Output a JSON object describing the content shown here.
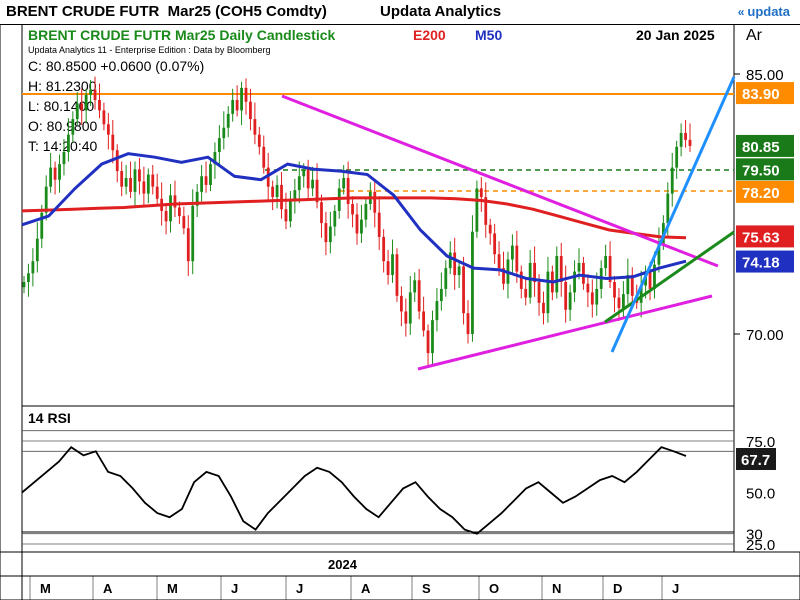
{
  "header": {
    "left": "BRENT CRUDE FUTR  Mar25 (COH5 Comdty)",
    "right": "Updata Analytics",
    "logo": "updata",
    "logo_icon": "chevron-logo-icon"
  },
  "chart_title": {
    "name": "BRENT CRUDE FUTR  Mar25 Daily Candlestick",
    "e200": "E200",
    "m50": "M50",
    "date": "20 Jan 2025",
    "axis_label": "Ar",
    "sub": "Updata Analytics 11 - Enterprise Edition : Data by Bloomberg"
  },
  "ohlc": {
    "c": "C: 80.8500  +0.0600 (0.07%)",
    "h": "H: 81.2300",
    "l": "L: 80.1400",
    "o": "O: 80.9800",
    "t": "T: 14:20:40"
  },
  "colors": {
    "up": "#1a8a1a",
    "down": "#e02020",
    "e200": "#e02020",
    "m50": "#2030c0",
    "magenta": "#e020e0",
    "orange": "#ff8c00",
    "green_dashed": "#1a7a1a",
    "blue_line": "#1e90ff",
    "green_line": "#1a8a1a"
  },
  "chart_data": [
    {
      "type": "candlestick",
      "title": "BRENT CRUDE FUTR  Mar25 Daily Candlestick",
      "y_ticks": [
        85,
        70
      ],
      "y_tick_labels": [
        "85.00",
        "70.00"
      ],
      "ylim": [
        67.4,
        87.0
      ],
      "x_month_labels": [
        "M",
        "A",
        "M",
        "J",
        "J",
        "A",
        "S",
        "O",
        "N",
        "D",
        "J"
      ],
      "x_year_label": "2024",
      "series_closes": [
        73.0,
        73.5,
        74.2,
        75.5,
        77.0,
        78.5,
        79.6,
        78.9,
        79.8,
        80.5,
        81.5,
        82.4,
        83.3,
        82.9,
        83.8,
        84.1,
        83.5,
        82.9,
        82.1,
        81.5,
        80.6,
        79.4,
        78.5,
        79.0,
        78.2,
        79.5,
        78.8,
        78.1,
        79.2,
        78.5,
        77.8,
        77.1,
        76.5,
        78.0,
        77.3,
        76.8,
        76.1,
        74.2,
        77.4,
        78.2,
        79.1,
        78.6,
        79.8,
        80.5,
        81.3,
        81.9,
        82.7,
        83.5,
        82.9,
        84.2,
        83.4,
        82.4,
        81.5,
        80.8,
        79.6,
        78.5,
        77.9,
        78.6,
        77.2,
        76.5,
        77.8,
        78.3,
        79.1,
        79.5,
        78.4,
        78.9,
        77.6,
        76.4,
        75.3,
        76.2,
        77.1,
        78.4,
        79.0,
        77.5,
        76.9,
        75.8,
        76.6,
        77.5,
        78.2,
        77.0,
        75.6,
        74.2,
        73.4,
        74.6,
        72.2,
        71.3,
        70.6,
        72.4,
        73.1,
        71.3,
        70.2,
        68.9,
        70.8,
        71.9,
        72.6,
        73.8,
        74.7,
        73.4,
        73.9,
        71.2,
        70.0,
        75.9,
        78.4,
        77.9,
        76.3,
        75.8,
        74.6,
        73.8,
        72.9,
        74.3,
        75.1,
        73.6,
        72.6,
        72.1,
        74.1,
        73.0,
        71.8,
        71.2,
        73.6,
        72.4,
        74.5,
        73.0,
        71.4,
        72.4,
        73.6,
        74.1,
        72.9,
        72.4,
        71.7,
        72.6,
        73.8,
        74.5,
        73.0,
        72.1,
        71.5,
        72.3,
        73.4,
        72.2,
        71.8,
        72.8,
        73.6,
        72.6,
        74.0,
        75.2,
        76.4,
        78.1,
        79.6,
        80.8,
        81.6,
        81.2,
        80.85
      ],
      "series": [
        {
          "name": "E200",
          "values": [
            77.1,
            77.15,
            77.2,
            77.25,
            77.3,
            77.4,
            77.5,
            77.55,
            77.6,
            77.65,
            77.7,
            77.75,
            77.8,
            77.85,
            77.85,
            77.85,
            77.85,
            77.8,
            77.7,
            77.5,
            77.2,
            76.8,
            76.4,
            76.0,
            75.8,
            75.6,
            75.55
          ]
        },
        {
          "name": "M50",
          "values": [
            76.3,
            76.8,
            78.4,
            79.8,
            80.4,
            80.2,
            79.9,
            80.2,
            79.1,
            78.9,
            79.8,
            79.5,
            79.4,
            79.2,
            78.0,
            76.0,
            74.5,
            73.8,
            73.7,
            73.2,
            73.0,
            73.4,
            73.2,
            73.3,
            73.8,
            74.2
          ]
        },
        {
          "name": "14 RSI",
          "values": [
            50,
            55,
            60,
            65,
            72,
            68,
            70,
            60,
            58,
            52,
            45,
            40,
            38,
            42,
            55,
            60,
            58,
            48,
            36,
            32,
            40,
            46,
            52,
            58,
            62,
            60,
            55,
            48,
            42,
            38,
            45,
            52,
            55,
            48,
            42,
            38,
            32,
            30,
            35,
            40,
            46,
            52,
            55,
            50,
            45,
            48,
            52,
            56,
            58,
            55,
            60,
            66,
            72,
            70,
            67.7
          ]
        }
      ],
      "price_labels": [
        {
          "value": "83.90",
          "color": "#ff8c00"
        },
        {
          "value": "80.85",
          "color": "#1a7a1a"
        },
        {
          "value": "79.50",
          "color": "#1a7a1a"
        },
        {
          "value": "78.20",
          "color": "#ff8c00"
        },
        {
          "value": "75.63",
          "color": "#e02020"
        },
        {
          "value": "74.18",
          "color": "#2030c0"
        }
      ]
    },
    {
      "type": "line",
      "title": "14 RSI",
      "y_ticks": [
        75,
        50,
        30,
        25
      ],
      "y_tick_labels": [
        "75.0",
        "50.0",
        "30",
        "25.0"
      ],
      "ylim": [
        23,
        80
      ],
      "current_value": "67.7"
    }
  ]
}
